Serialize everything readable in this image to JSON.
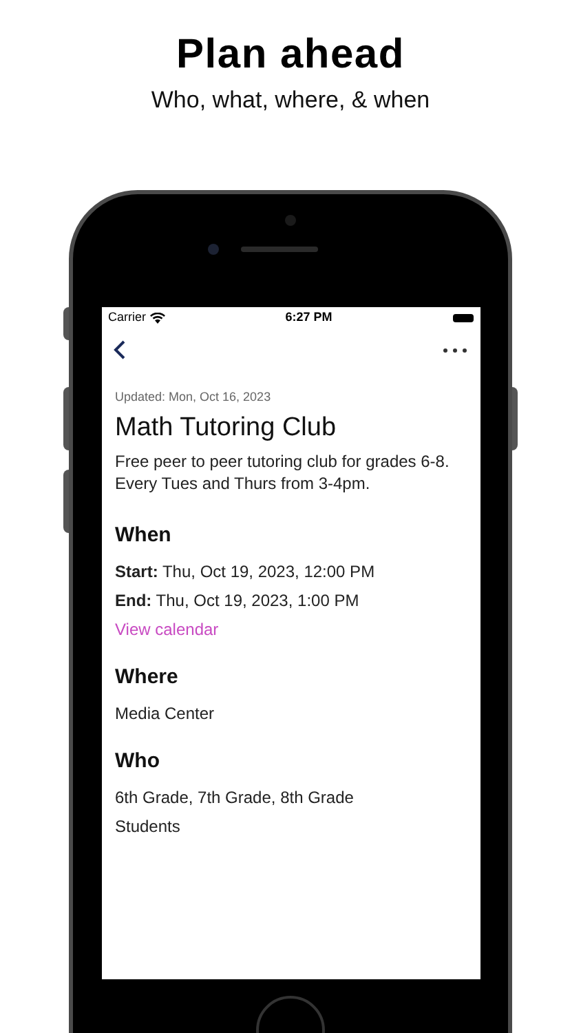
{
  "headline": "Plan ahead",
  "subheadline": "Who, what, where, & when",
  "status_bar": {
    "carrier": "Carrier",
    "time": "6:27 PM"
  },
  "event": {
    "updated": "Updated: Mon, Oct 16, 2023",
    "title": "Math Tutoring Club",
    "description": "Free peer to peer tutoring club for grades 6-8. Every Tues and Thurs from 3-4pm."
  },
  "sections": [
    {
      "heading": "When",
      "lines": [
        {
          "kind": "field",
          "label": "Start:",
          "value": "Thu, Oct 19, 2023, 12:00 PM"
        },
        {
          "kind": "field",
          "label": "End:",
          "value": "Thu, Oct 19, 2023, 1:00 PM"
        },
        {
          "kind": "link",
          "value": "View calendar"
        }
      ]
    },
    {
      "heading": "Where",
      "lines": [
        {
          "kind": "text",
          "value": "Media Center"
        }
      ]
    },
    {
      "heading": "Who",
      "lines": [
        {
          "kind": "text",
          "value": "6th Grade, 7th Grade, 8th Grade"
        },
        {
          "kind": "text",
          "value": "Students"
        }
      ]
    }
  ]
}
